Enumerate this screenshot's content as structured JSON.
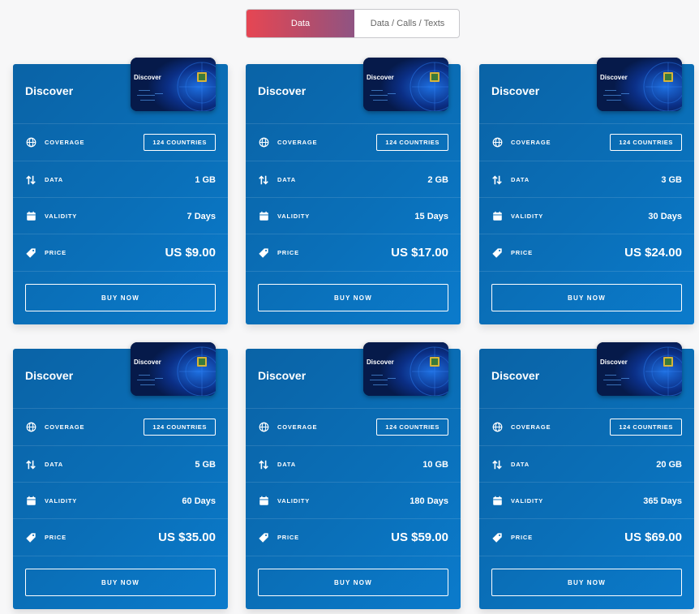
{
  "toggle": {
    "options": [
      "Data",
      "Data / Calls / Texts"
    ]
  },
  "labels": {
    "coverage": "COVERAGE",
    "data": "DATA",
    "validity": "VALIDITY",
    "price": "PRICE",
    "buy": "BUY NOW"
  },
  "sim_label": "Discover",
  "plans": [
    {
      "name": "Discover",
      "coverage": "124 COUNTRIES",
      "data": "1 GB",
      "validity": "7 Days",
      "price": "US $9.00"
    },
    {
      "name": "Discover",
      "coverage": "124 COUNTRIES",
      "data": "2 GB",
      "validity": "15 Days",
      "price": "US $17.00"
    },
    {
      "name": "Discover",
      "coverage": "124 COUNTRIES",
      "data": "3 GB",
      "validity": "30 Days",
      "price": "US $24.00"
    },
    {
      "name": "Discover",
      "coverage": "124 COUNTRIES",
      "data": "5 GB",
      "validity": "60 Days",
      "price": "US $35.00"
    },
    {
      "name": "Discover",
      "coverage": "124 COUNTRIES",
      "data": "10 GB",
      "validity": "180 Days",
      "price": "US $59.00"
    },
    {
      "name": "Discover",
      "coverage": "124 COUNTRIES",
      "data": "20 GB",
      "validity": "365 Days",
      "price": "US $69.00"
    }
  ],
  "icons": {
    "coverage": "globe-icon",
    "data": "arrows-up-down-icon",
    "validity": "calendar-icon",
    "price": "tag-icon"
  },
  "colors": {
    "card_blue": "#0a6fb8",
    "toggle_active_start": "#e64653",
    "toggle_active_end": "#8f5483"
  }
}
